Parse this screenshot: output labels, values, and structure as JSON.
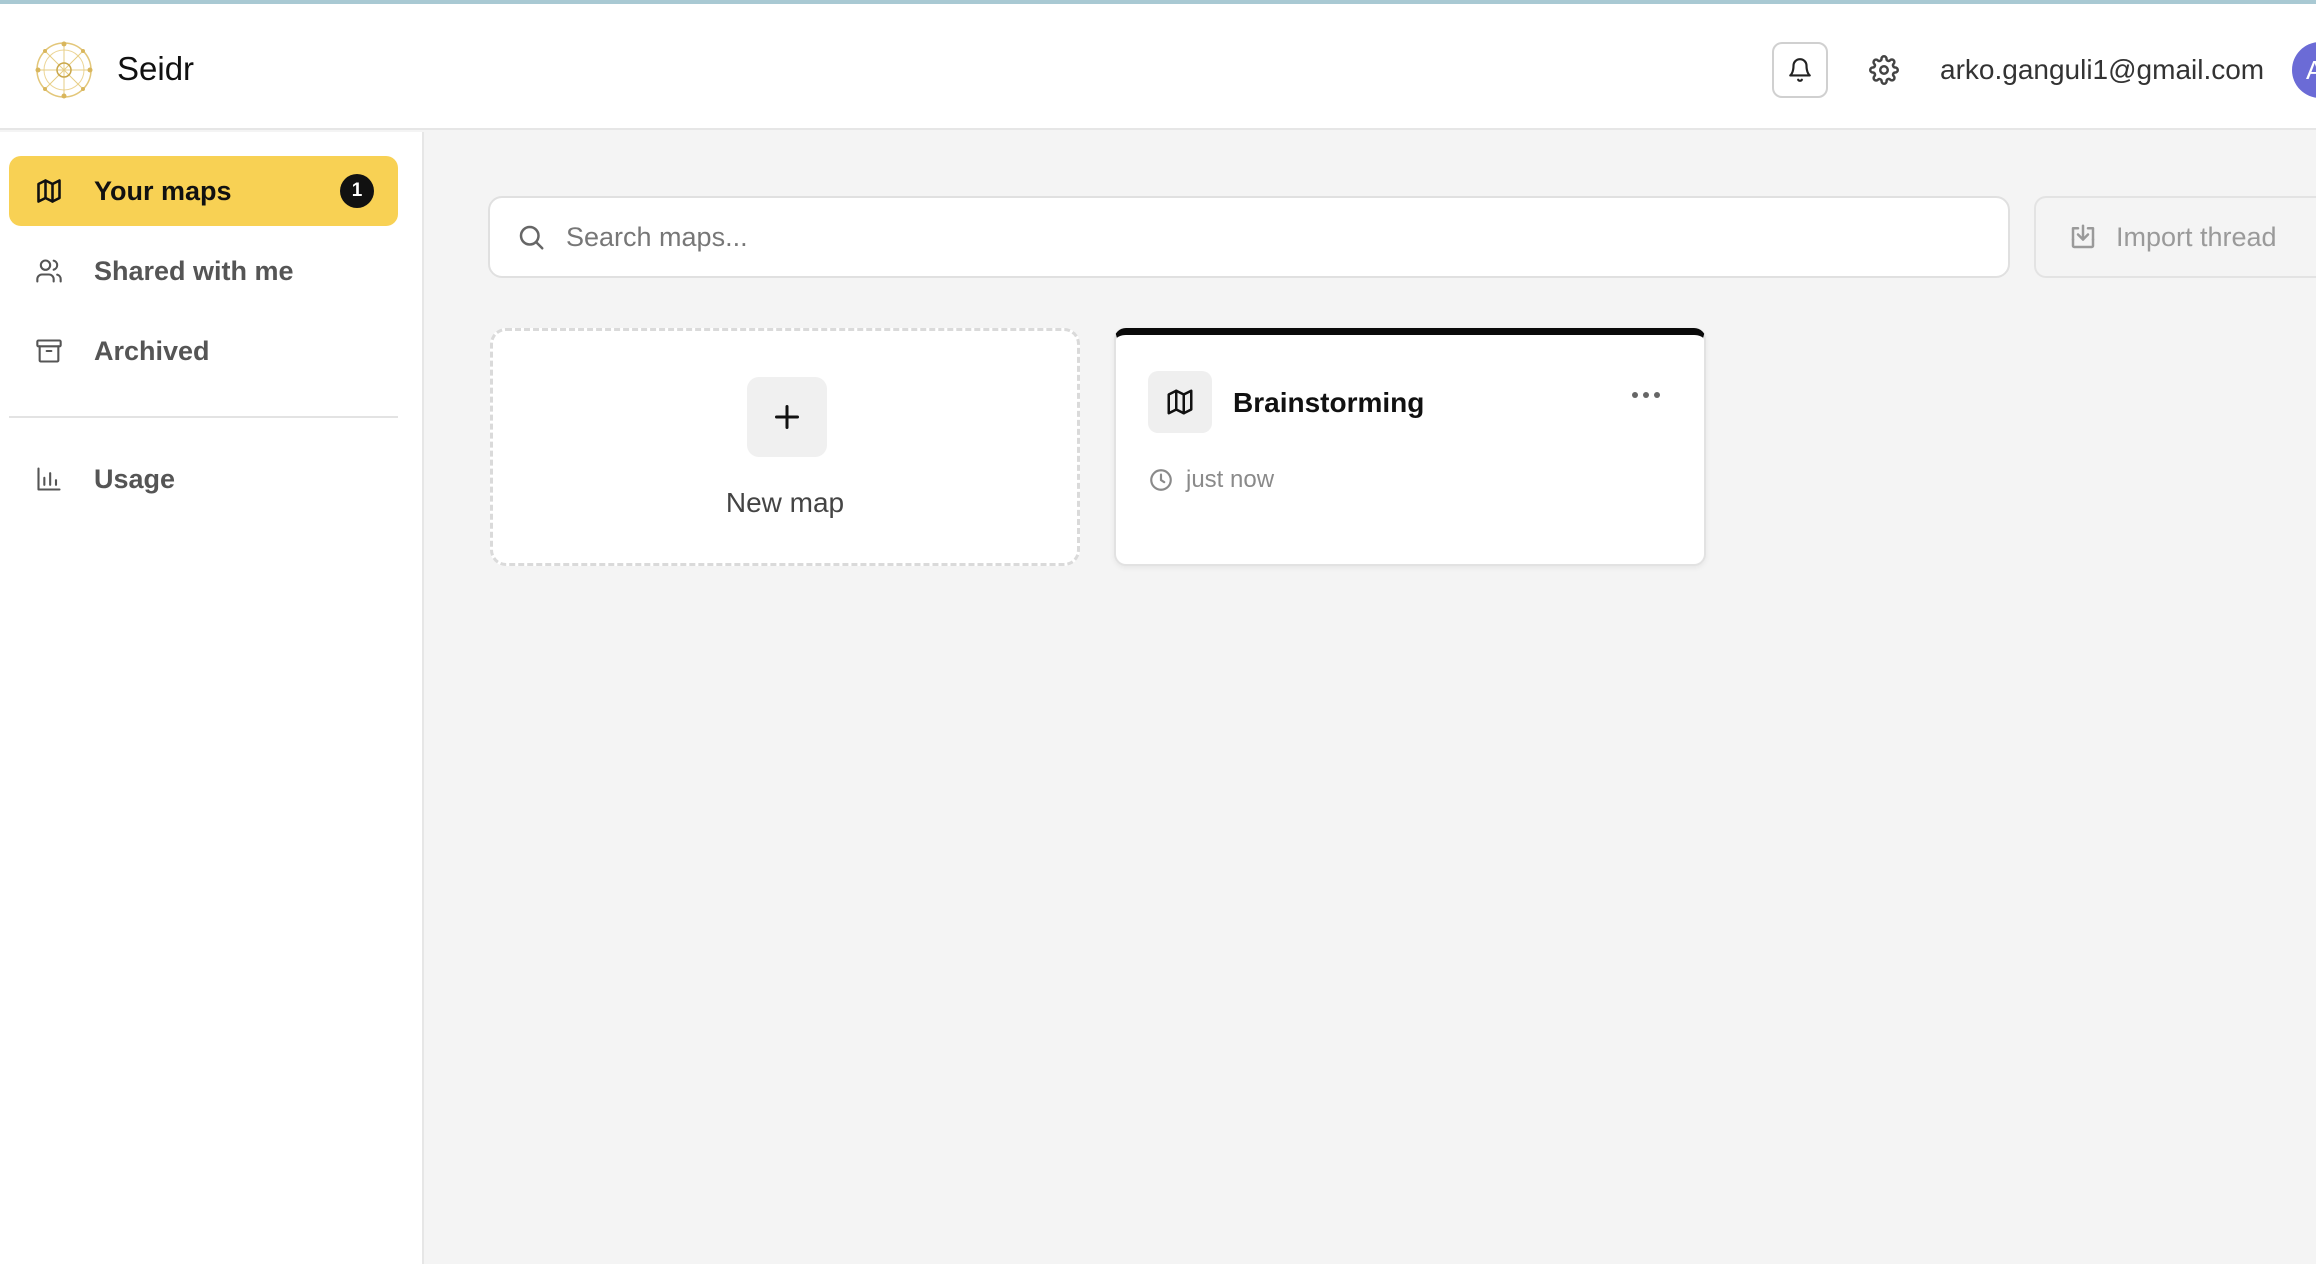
{
  "app": {
    "title": "Seidr"
  },
  "header": {
    "email": "arko.ganguli1@gmail.com",
    "avatar_initial": "A"
  },
  "sidebar": {
    "items": [
      {
        "label": "Your maps",
        "badge": "1",
        "icon": "map-icon",
        "active": true
      },
      {
        "label": "Shared with me",
        "icon": "users-icon"
      },
      {
        "label": "Archived",
        "icon": "archive-icon"
      },
      {
        "label": "Usage",
        "icon": "bar-chart-icon"
      }
    ]
  },
  "search": {
    "placeholder": "Search maps..."
  },
  "toolbar": {
    "import_label": "Import thread"
  },
  "new_map": {
    "label": "New map"
  },
  "maps": [
    {
      "title": "Brainstorming",
      "time": "just now"
    }
  ],
  "colors": {
    "accent": "#f8d154",
    "avatar": "#6b6bd6",
    "card_top_border": "#0a0a0a"
  }
}
